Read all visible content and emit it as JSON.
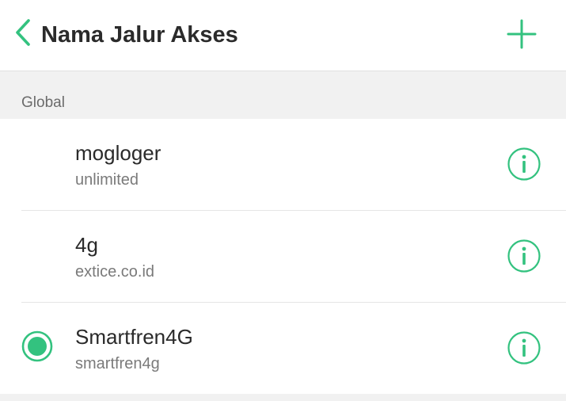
{
  "header": {
    "title": "Nama Jalur Akses",
    "back_icon": "chevron-left-icon",
    "add_icon": "plus-icon"
  },
  "section": {
    "label": "Global"
  },
  "apns": [
    {
      "name": "mogloger",
      "apn": "unlimited",
      "selected": false
    },
    {
      "name": "4g",
      "apn": "extice.co.id",
      "selected": false
    },
    {
      "name": "Smartfren4G",
      "apn": "smartfren4g",
      "selected": true
    }
  ],
  "colors": {
    "accent": "#33c27f",
    "title_text": "#2b2b2b",
    "section_bg": "#f1f1f1",
    "subtext": "#7a7a7a"
  }
}
